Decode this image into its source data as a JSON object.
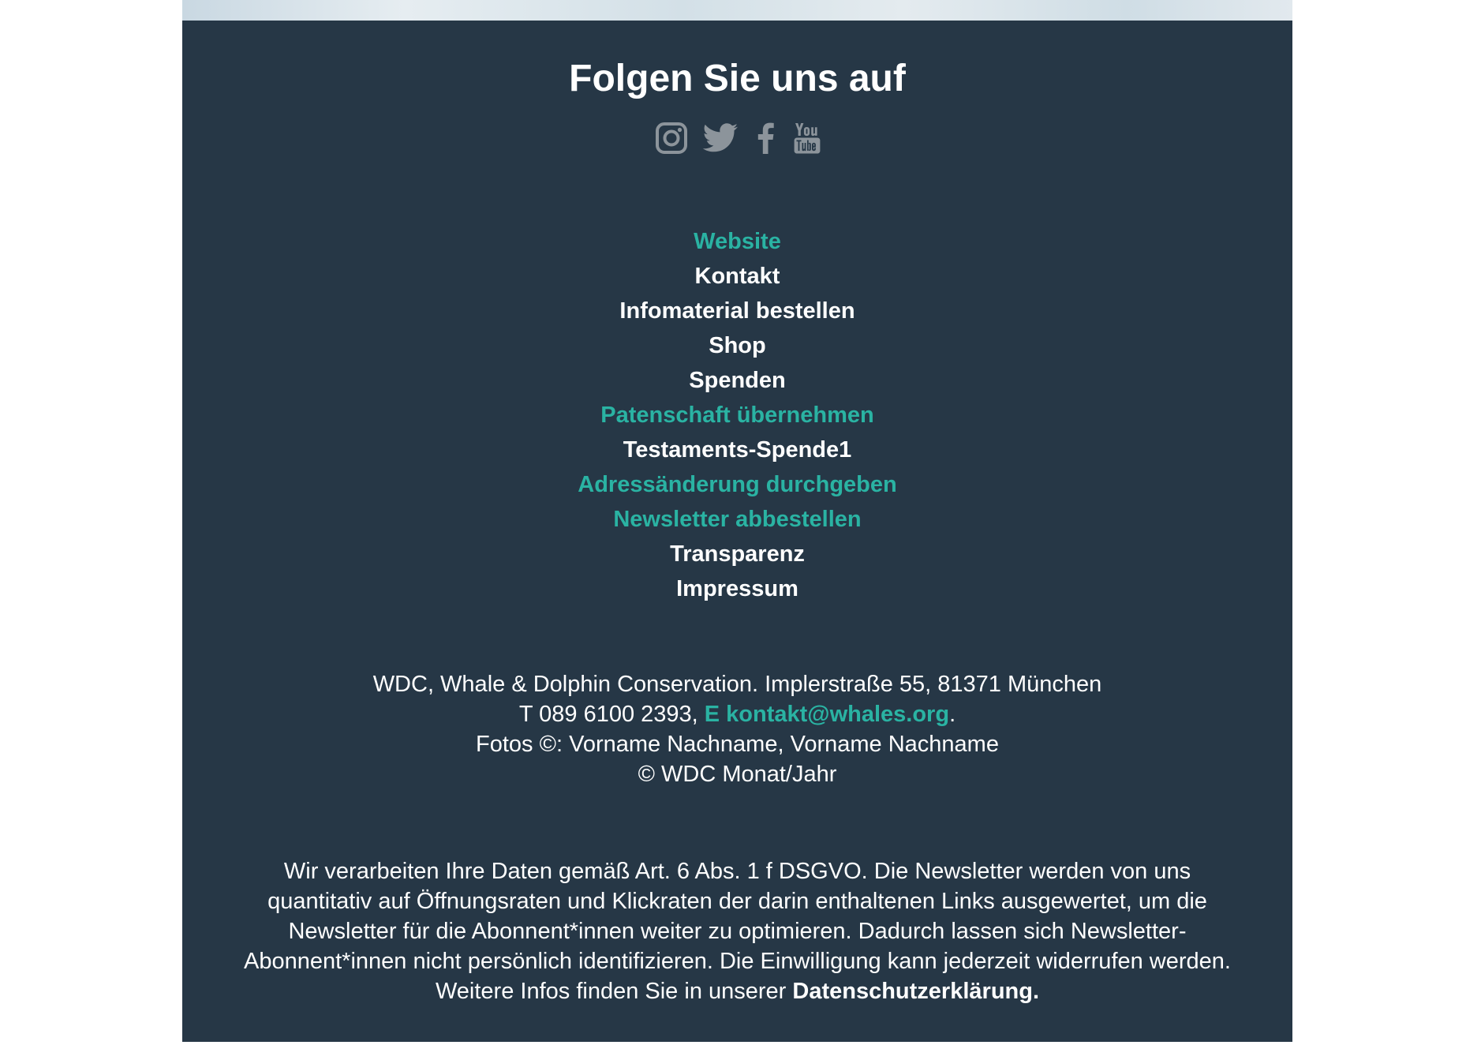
{
  "colors": {
    "footer_background": "#263746",
    "link_teal": "#2ab3a3",
    "text_white": "#ffffff",
    "icon_gray": "#8c949b"
  },
  "social": {
    "title": "Folgen Sie uns auf",
    "icons": [
      "instagram-icon",
      "twitter-icon",
      "facebook-icon",
      "youtube-icon"
    ]
  },
  "menu": {
    "items": [
      {
        "label": "Website",
        "style": "teal"
      },
      {
        "label": "Kontakt",
        "style": "white"
      },
      {
        "label": "Infomaterial bestellen",
        "style": "white"
      },
      {
        "label": "Shop",
        "style": "white"
      },
      {
        "label": "Spenden",
        "style": "white"
      },
      {
        "label": "Patenschaft übernehmen",
        "style": "teal"
      },
      {
        "label": "Testaments-Spende1",
        "style": "white"
      },
      {
        "label": "Adressänderung durchgeben",
        "style": "teal"
      },
      {
        "label": "Newsletter abbestellen",
        "style": "teal"
      },
      {
        "label": "Transparenz",
        "style": "white"
      },
      {
        "label": "Impressum",
        "style": "white"
      }
    ]
  },
  "address": {
    "line1": "WDC, Whale & Dolphin Conservation. Implerstraße 55, 81371 München",
    "phone": "T 089 6100 2393, ",
    "email_label": "E kontakt@whales.org",
    "email_suffix": ".",
    "photos": "Fotos ©: Vorname Nachname, Vorname Nachname",
    "copyright": "© WDC Monat/Jahr"
  },
  "legal": {
    "line1": "Wir verarbeiten Ihre Daten gemäß Art. 6 Abs. 1 f DSGVO. Die Newsletter werden von uns",
    "line2": "quantitativ auf Öffnungsraten und Klickraten der darin enthaltenen Links ausgewertet, um die",
    "line3": "Newsletter für die Abonnent*innen weiter zu optimieren. Dadurch lassen sich Newsletter-",
    "line4": "Abonnent*innen nicht persönlich identifizieren. Die Einwilligung kann jederzeit widerrufen werden.",
    "line5_prefix": "Weitere Infos finden Sie in unserer ",
    "privacy_link": "Datenschutzerklärung."
  }
}
